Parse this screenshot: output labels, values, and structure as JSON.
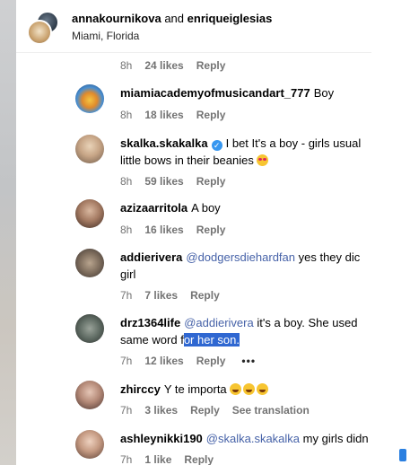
{
  "header": {
    "user1": "annakournikova",
    "conj": "and",
    "user2": "enriqueiglesias",
    "location": "Miami, Florida"
  },
  "top_meta": {
    "time": "8h",
    "likes": "24 likes",
    "reply": "Reply"
  },
  "comments": [
    {
      "user": "miamiacademyofmusicandart_777",
      "line1": "Boy",
      "line2": "",
      "time": "8h",
      "likes": "18 likes",
      "reply": "Reply"
    },
    {
      "user": "skalka.skakalka",
      "verified": true,
      "line1": "I bet It's a boy - girls usual",
      "line2": "little bows in their beanies",
      "emoji": "smiling-face-with-heart-eyes",
      "time": "8h",
      "likes": "59 likes",
      "reply": "Reply"
    },
    {
      "user": "azizaarritola",
      "line1": "A boy",
      "line2": "",
      "time": "8h",
      "likes": "16 likes",
      "reply": "Reply"
    },
    {
      "user": "addierivera",
      "mention": "@dodgersdiehardfan",
      "line1": "yes they dic",
      "line2": "girl",
      "time": "7h",
      "likes": "7 likes",
      "reply": "Reply"
    },
    {
      "user": "drz1364life",
      "mention": "@addierivera",
      "line1": "it's a boy. She used",
      "line2_plain": "same word f",
      "line2_selected": "or her son.",
      "time": "7h",
      "likes": "12 likes",
      "reply": "Reply",
      "more": "•••"
    },
    {
      "user": "zhirccy",
      "line1": "Y te importa",
      "emoji": "face-with-tears-of-joy",
      "time": "7h",
      "likes": "3 likes",
      "reply": "Reply",
      "see_translation": "See translation"
    },
    {
      "user": "ashleynikki190",
      "mention": "@skalka.skakalka",
      "line1": "my girls didn",
      "time": "7h",
      "likes": "1 like",
      "reply": "Reply"
    }
  ],
  "colors": {
    "mention": "#4662a8",
    "meta": "#737373",
    "verified": "#3797f0",
    "selection": "#2f67d1"
  }
}
